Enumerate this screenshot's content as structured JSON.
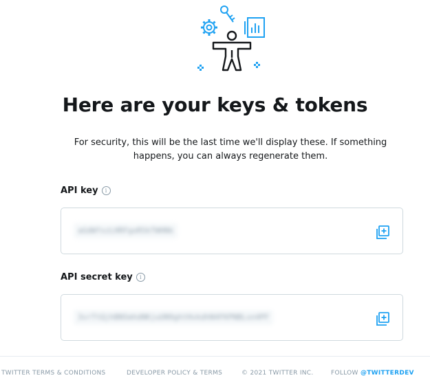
{
  "header": {
    "illustration_icon": "developer-keys-illustration",
    "title": "Here are your keys & tokens",
    "subtitle": "For security, this will be the last time we'll display these. If something happens, you can always regenerate them."
  },
  "fields": [
    {
      "label": "API key",
      "value": "aGdWfxzLHRFgoRSkTWHNk",
      "info_icon": "info-icon",
      "copy_icon": "copy-icon"
    },
    {
      "label": "API secret key",
      "value": "3vrTtQjhBNSmhdNKjuUN9ghtHvkdhN4FKPNBLsn4PF",
      "info_icon": "info-icon",
      "copy_icon": "copy-icon"
    }
  ],
  "footer": {
    "terms": "TWITTER TERMS & CONDITIONS",
    "policy": "DEVELOPER POLICY & TERMS",
    "copyright": "© 2021 TWITTER INC.",
    "follow": "FOLLOW",
    "handle": "@TWITTERDEV"
  },
  "colors": {
    "accent": "#1da1f2",
    "text": "#14171a",
    "border": "#cfd9de",
    "muted": "#8899a6"
  }
}
